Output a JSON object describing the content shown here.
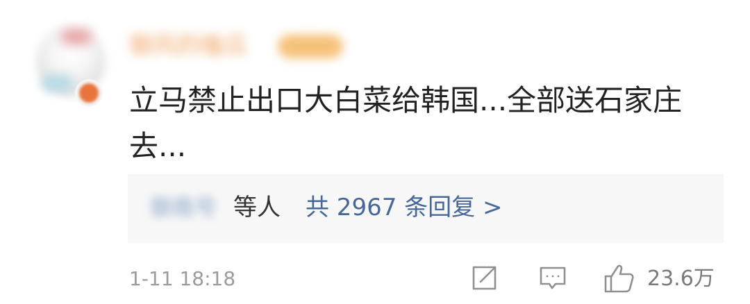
{
  "comment": {
    "username": "御风的嗑瓜",
    "text": "立马禁止出口大白菜给韩国...全部送石家庄去...",
    "replies": {
      "names": "御南号",
      "others_label": "等人",
      "link_label": "共 2967 条回复 >"
    },
    "timestamp": "1-11 18:18",
    "likes": "23.6万"
  },
  "icons": [
    "share-icon",
    "comment-icon",
    "like-icon"
  ],
  "colors": {
    "link": "#45679a",
    "meta": "#9b9b9b",
    "reply_bg": "#f7f7f7",
    "badge_orange": "#e8743b"
  }
}
